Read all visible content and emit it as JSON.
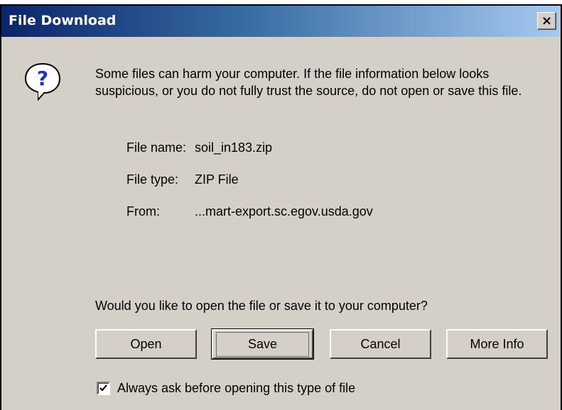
{
  "window": {
    "title": "File Download",
    "close_label": "×"
  },
  "message": {
    "text": "Some files can harm your computer. If the file information below looks suspicious, or you do not fully trust the source, do not open or save this file.",
    "icon": "question-icon"
  },
  "file_info": {
    "name_label": "File name:",
    "name_value": "soil_in183.zip",
    "type_label": "File type:",
    "type_value": "ZIP File",
    "from_label": "From:",
    "from_value": "...mart-export.sc.egov.usda.gov"
  },
  "prompt": "Would you like to open the file or save it to your computer?",
  "buttons": {
    "open": "Open",
    "save": "Save",
    "cancel": "Cancel",
    "more_info": "More Info"
  },
  "checkbox": {
    "label": "Always ask before opening this type of file",
    "checked": true
  },
  "colors": {
    "title_bar_start": "#0a246a",
    "title_bar_end": "#a6caf0",
    "dialog_bg": "#d4d0c8"
  }
}
